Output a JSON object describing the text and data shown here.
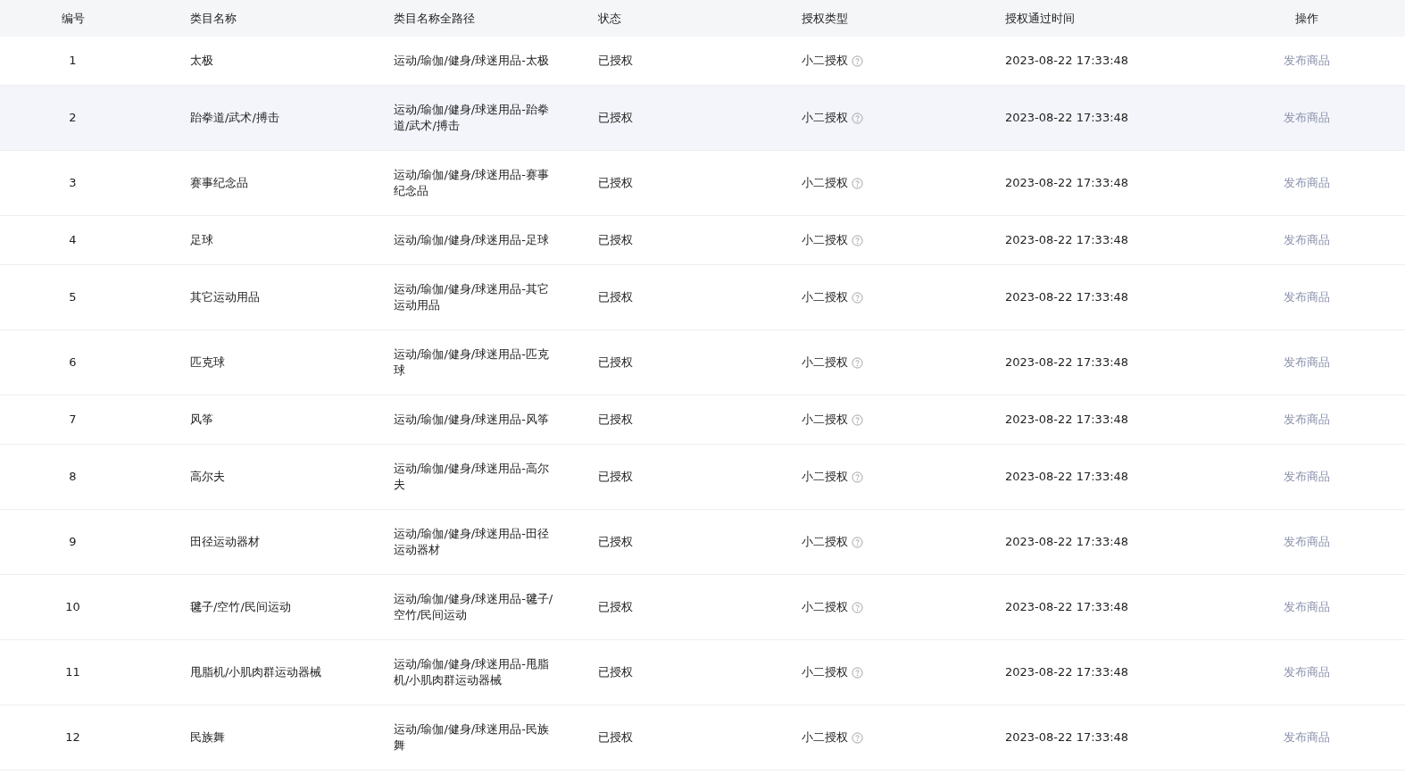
{
  "table": {
    "columns": [
      "编号",
      "类目名称",
      "类目名称全路径",
      "状态",
      "授权类型",
      "授权通过时间",
      "操作"
    ],
    "rows": [
      {
        "no": "1",
        "name": "太极",
        "path": "运动/瑜伽/健身/球迷用品-太极",
        "status": "已授权",
        "auth_type": "小二授权",
        "time": "2023-08-22 17:33:48",
        "action": "发布商品",
        "selected": false
      },
      {
        "no": "2",
        "name": "跆拳道/武术/搏击",
        "path": "运动/瑜伽/健身/球迷用品-跆拳道/武术/搏击",
        "status": "已授权",
        "auth_type": "小二授权",
        "time": "2023-08-22 17:33:48",
        "action": "发布商品",
        "selected": true
      },
      {
        "no": "3",
        "name": "赛事纪念品",
        "path": "运动/瑜伽/健身/球迷用品-赛事纪念品",
        "status": "已授权",
        "auth_type": "小二授权",
        "time": "2023-08-22 17:33:48",
        "action": "发布商品",
        "selected": false
      },
      {
        "no": "4",
        "name": "足球",
        "path": "运动/瑜伽/健身/球迷用品-足球",
        "status": "已授权",
        "auth_type": "小二授权",
        "time": "2023-08-22 17:33:48",
        "action": "发布商品",
        "selected": false
      },
      {
        "no": "5",
        "name": "其它运动用品",
        "path": "运动/瑜伽/健身/球迷用品-其它运动用品",
        "status": "已授权",
        "auth_type": "小二授权",
        "time": "2023-08-22 17:33:48",
        "action": "发布商品",
        "selected": false
      },
      {
        "no": "6",
        "name": "匹克球",
        "path": "运动/瑜伽/健身/球迷用品-匹克球",
        "status": "已授权",
        "auth_type": "小二授权",
        "time": "2023-08-22 17:33:48",
        "action": "发布商品",
        "selected": false
      },
      {
        "no": "7",
        "name": "风筝",
        "path": "运动/瑜伽/健身/球迷用品-风筝",
        "status": "已授权",
        "auth_type": "小二授权",
        "time": "2023-08-22 17:33:48",
        "action": "发布商品",
        "selected": false
      },
      {
        "no": "8",
        "name": "高尔夫",
        "path": "运动/瑜伽/健身/球迷用品-高尔夫",
        "status": "已授权",
        "auth_type": "小二授权",
        "time": "2023-08-22 17:33:48",
        "action": "发布商品",
        "selected": false
      },
      {
        "no": "9",
        "name": "田径运动器材",
        "path": "运动/瑜伽/健身/球迷用品-田径运动器材",
        "status": "已授权",
        "auth_type": "小二授权",
        "time": "2023-08-22 17:33:48",
        "action": "发布商品",
        "selected": false
      },
      {
        "no": "10",
        "name": "毽子/空竹/民间运动",
        "path": "运动/瑜伽/健身/球迷用品-毽子/空竹/民间运动",
        "status": "已授权",
        "auth_type": "小二授权",
        "time": "2023-08-22 17:33:48",
        "action": "发布商品",
        "selected": false
      },
      {
        "no": "11",
        "name": "甩脂机/小肌肉群运动器械",
        "path": "运动/瑜伽/健身/球迷用品-甩脂机/小肌肉群运动器械",
        "status": "已授权",
        "auth_type": "小二授权",
        "time": "2023-08-22 17:33:48",
        "action": "发布商品",
        "selected": false
      },
      {
        "no": "12",
        "name": "民族舞",
        "path": "运动/瑜伽/健身/球迷用品-民族舞",
        "status": "已授权",
        "auth_type": "小二授权",
        "time": "2023-08-22 17:33:48",
        "action": "发布商品",
        "selected": false
      }
    ]
  }
}
